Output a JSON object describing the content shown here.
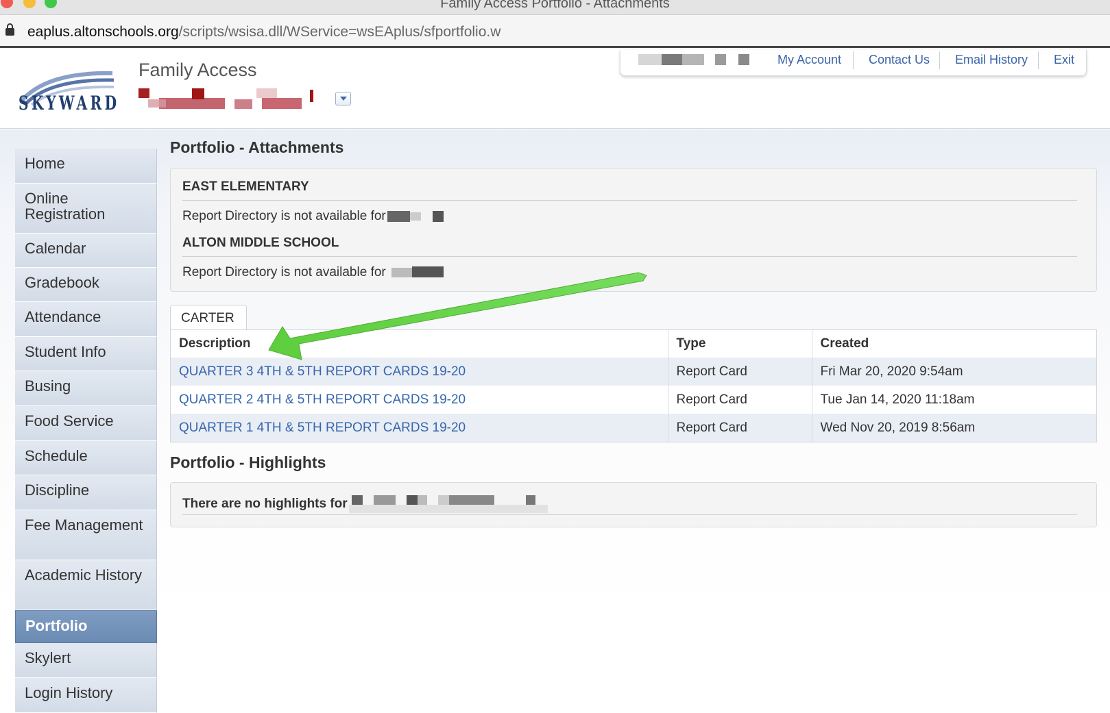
{
  "window": {
    "title": "Family Access Portfolio - Attachments"
  },
  "browser": {
    "url_host": "eaplus.altonschools.org",
    "url_path": "/scripts/wsisa.dll/WService=wsEAplus/sfportfolio.w"
  },
  "header": {
    "logo_text": "SKYWARD",
    "app_title": "Family Access",
    "links": [
      "My Account",
      "Contact Us",
      "Email History",
      "Exit"
    ]
  },
  "sidebar": {
    "items": [
      "Home",
      "Online Registration",
      "Calendar",
      "Gradebook",
      "Attendance",
      "Student Info",
      "Busing",
      "Food Service",
      "Schedule",
      "Discipline",
      "Fee Management",
      "Academic History",
      "Portfolio",
      "Skylert",
      "Login History"
    ],
    "active": "Portfolio"
  },
  "attachments": {
    "title": "Portfolio - Attachments",
    "schools": [
      {
        "name": "EAST ELEMENTARY",
        "message": "Report Directory is not available for"
      },
      {
        "name": "ALTON MIDDLE SCHOOL",
        "message": "Report Directory is not available for"
      }
    ],
    "student_tab": "CARTER",
    "table": {
      "headers": [
        "Description",
        "Type",
        "Created"
      ],
      "rows": [
        {
          "description": "QUARTER 3 4TH & 5TH REPORT CARDS 19-20",
          "type": "Report Card",
          "created": "Fri Mar 20, 2020 9:54am"
        },
        {
          "description": "QUARTER 2 4TH & 5TH REPORT CARDS 19-20",
          "type": "Report Card",
          "created": "Tue Jan 14, 2020 11:18am"
        },
        {
          "description": "QUARTER 1 4TH & 5TH REPORT CARDS 19-20",
          "type": "Report Card",
          "created": "Wed Nov 20, 2019 8:56am"
        }
      ]
    }
  },
  "highlights": {
    "title": "Portfolio - Highlights",
    "message": "There are no highlights for"
  },
  "colors": {
    "link": "#3566ad",
    "sidebar_active": "#6f8fb6",
    "annotation_arrow": "#5fd33f",
    "redaction": "#9a1c1c"
  }
}
